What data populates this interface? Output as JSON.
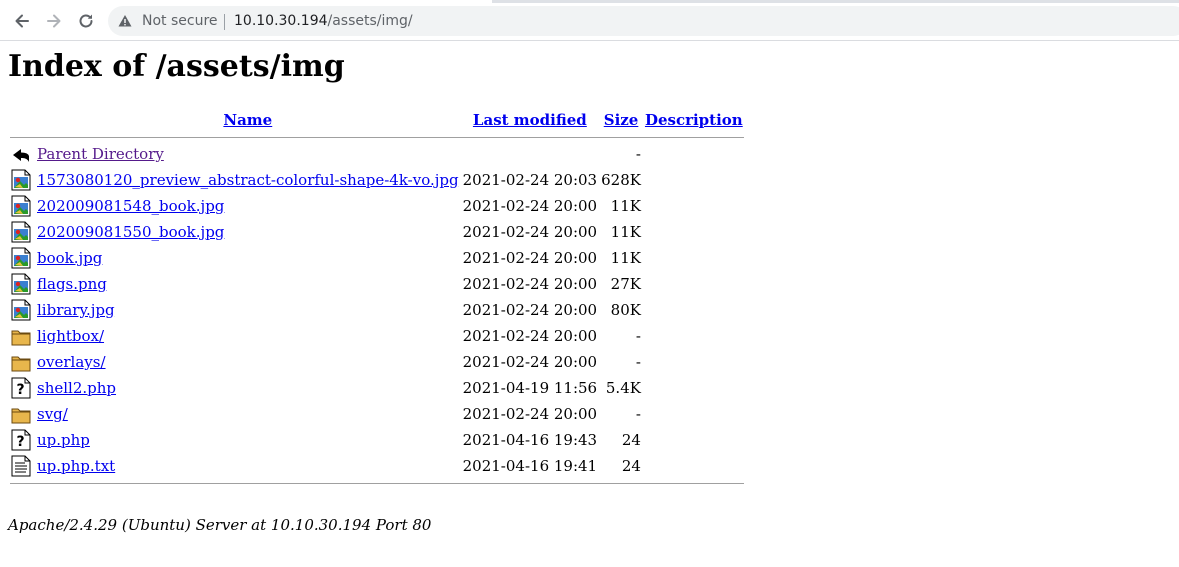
{
  "browser": {
    "security_label": "Not secure",
    "url_host": "10.10.30.194",
    "url_path": "/assets/img/"
  },
  "page": {
    "title": "Index of /assets/img",
    "columns": {
      "name": "Name",
      "last_modified": "Last modified",
      "size": "Size",
      "description": "Description"
    },
    "parent": {
      "label": "Parent Directory",
      "size": "-"
    },
    "entries": [
      {
        "name": "1573080120_preview_abstract-colorful-shape-4k-vo.jpg",
        "modified": "2021-02-24 20:03",
        "size": "628K",
        "icon": "image-icon"
      },
      {
        "name": "202009081548_book.jpg",
        "modified": "2021-02-24 20:00",
        "size": "11K",
        "icon": "image-icon"
      },
      {
        "name": "202009081550_book.jpg",
        "modified": "2021-02-24 20:00",
        "size": "11K",
        "icon": "image-icon"
      },
      {
        "name": "book.jpg",
        "modified": "2021-02-24 20:00",
        "size": "11K",
        "icon": "image-icon"
      },
      {
        "name": "flags.png",
        "modified": "2021-02-24 20:00",
        "size": "27K",
        "icon": "image-icon"
      },
      {
        "name": "library.jpg",
        "modified": "2021-02-24 20:00",
        "size": "80K",
        "icon": "image-icon"
      },
      {
        "name": "lightbox/",
        "modified": "2021-02-24 20:00",
        "size": "-",
        "icon": "folder-icon"
      },
      {
        "name": "overlays/",
        "modified": "2021-02-24 20:00",
        "size": "-",
        "icon": "folder-icon"
      },
      {
        "name": "shell2.php",
        "modified": "2021-04-19 11:56",
        "size": "5.4K",
        "icon": "unknown-file-icon"
      },
      {
        "name": "svg/",
        "modified": "2021-02-24 20:00",
        "size": "-",
        "icon": "folder-icon"
      },
      {
        "name": "up.php",
        "modified": "2021-04-16 19:43",
        "size": "24",
        "icon": "unknown-file-icon"
      },
      {
        "name": "up.php.txt",
        "modified": "2021-04-16 19:41",
        "size": "24",
        "icon": "text-file-icon"
      }
    ],
    "footer": "Apache/2.4.29 (Ubuntu) Server at 10.10.30.194 Port 80"
  },
  "colors": {
    "link": "#0000ee",
    "visited_link": "#551a8b",
    "omnibox_bg": "#f1f3f4"
  }
}
